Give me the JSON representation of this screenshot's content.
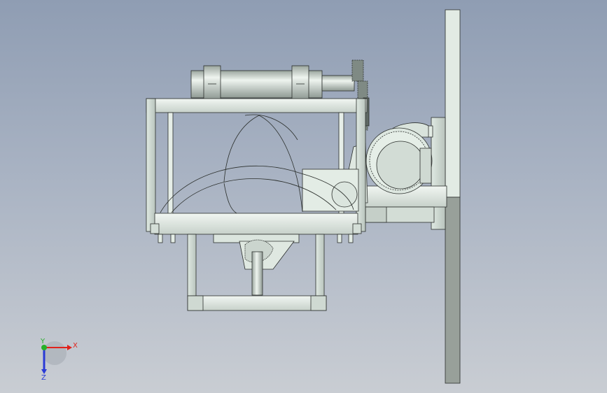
{
  "view": {
    "background_top": "#8f9db3",
    "background_bottom": "#c9cdd3",
    "part_color": "#e3ece5",
    "edge_color": "#2b2f2c"
  },
  "triad": {
    "x_label": "X",
    "y_label": "Y",
    "z_label": "Z",
    "x_color": "#e0221b",
    "y_color": "#26b02a",
    "z_color": "#2a3ad6"
  }
}
